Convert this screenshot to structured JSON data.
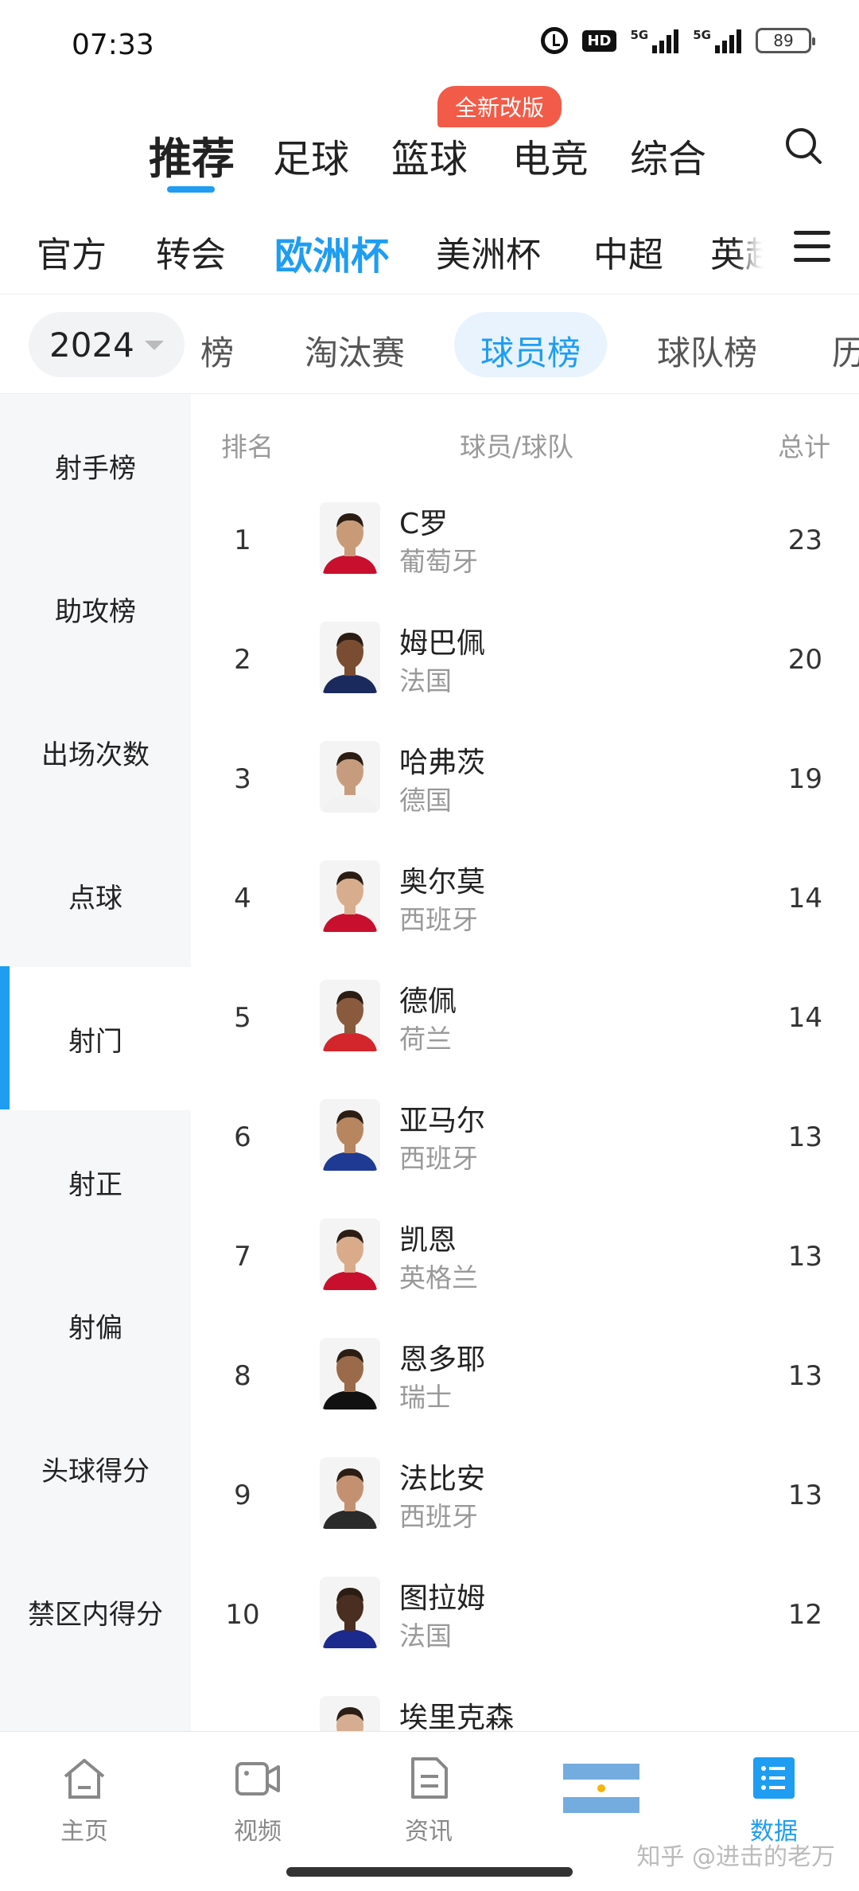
{
  "status_bar": {
    "time": "07:33",
    "hd_label": "HD",
    "signal1_label": "5G",
    "signal2_label": "5G",
    "battery": "89"
  },
  "top_tabs": {
    "items": [
      {
        "label": "推荐",
        "active": true
      },
      {
        "label": "足球",
        "active": false
      },
      {
        "label": "篮球",
        "active": false
      },
      {
        "label": "电竞",
        "active": false
      },
      {
        "label": "综合",
        "active": false
      }
    ],
    "new_badge": "全新改版"
  },
  "league_tabs": {
    "items": [
      {
        "label": "官方",
        "active": false
      },
      {
        "label": "转会",
        "active": false
      },
      {
        "label": "欧洲杯",
        "active": true
      },
      {
        "label": "美洲杯",
        "active": false
      },
      {
        "label": "中超",
        "active": false
      },
      {
        "label": "英超",
        "active": false
      }
    ]
  },
  "sub_tabs": {
    "year": "2024",
    "items": [
      {
        "label": "榜",
        "active": false
      },
      {
        "label": "淘汰赛",
        "active": false
      },
      {
        "label": "球员榜",
        "active": true
      },
      {
        "label": "球队榜",
        "active": false
      },
      {
        "label": "历",
        "active": false
      }
    ]
  },
  "side_nav": {
    "items": [
      {
        "label": "射手榜",
        "active": false
      },
      {
        "label": "助攻榜",
        "active": false
      },
      {
        "label": "出场次数",
        "active": false
      },
      {
        "label": "点球",
        "active": false
      },
      {
        "label": "射门",
        "active": true
      },
      {
        "label": "射正",
        "active": false
      },
      {
        "label": "射偏",
        "active": false
      },
      {
        "label": "头球得分",
        "active": false
      },
      {
        "label": "禁区内得分",
        "active": false
      }
    ]
  },
  "table": {
    "headers": {
      "rank": "排名",
      "player": "球员/球队",
      "total": "总计"
    },
    "rows": [
      {
        "rank": "1",
        "name": "C罗",
        "team": "葡萄牙",
        "total": "23",
        "jersey": "#c8102e",
        "skin": "#c99a78"
      },
      {
        "rank": "2",
        "name": "姆巴佩",
        "team": "法国",
        "total": "20",
        "jersey": "#1b2a5c",
        "skin": "#7a4d33"
      },
      {
        "rank": "3",
        "name": "哈弗茨",
        "team": "德国",
        "total": "19",
        "jersey": "#f2f2f2",
        "skin": "#c79c7e"
      },
      {
        "rank": "4",
        "name": "奥尔莫",
        "team": "西班牙",
        "total": "14",
        "jersey": "#c8102e",
        "skin": "#d7ad8d"
      },
      {
        "rank": "5",
        "name": "德佩",
        "team": "荷兰",
        "total": "14",
        "jersey": "#d2262c",
        "skin": "#8a5a3e"
      },
      {
        "rank": "6",
        "name": "亚马尔",
        "team": "西班牙",
        "total": "13",
        "jersey": "#1f3a93",
        "skin": "#b78560"
      },
      {
        "rank": "7",
        "name": "凯恩",
        "team": "英格兰",
        "total": "13",
        "jersey": "#c8102e",
        "skin": "#d9ab8b"
      },
      {
        "rank": "8",
        "name": "恩多耶",
        "team": "瑞士",
        "total": "13",
        "jersey": "#111111",
        "skin": "#9a6a4a"
      },
      {
        "rank": "9",
        "name": "法比安",
        "team": "西班牙",
        "total": "13",
        "jersey": "#2a2a2a",
        "skin": "#c39172"
      },
      {
        "rank": "10",
        "name": "图拉姆",
        "team": "法国",
        "total": "12",
        "jersey": "#1b2a8c",
        "skin": "#4a2e22"
      },
      {
        "rank": "",
        "name": "埃里克森",
        "team": "",
        "total": "",
        "jersey": "#c8102e",
        "skin": "#d6ad90"
      }
    ]
  },
  "bottom_nav": {
    "items": [
      {
        "label": "主页",
        "icon": "home-icon",
        "active": false
      },
      {
        "label": "视频",
        "icon": "video-icon",
        "active": false
      },
      {
        "label": "资讯",
        "icon": "news-icon",
        "active": false
      },
      {
        "label": "",
        "icon": "argentina-flag-icon",
        "active": false
      },
      {
        "label": "数据",
        "icon": "data-icon",
        "active": true
      }
    ],
    "watermark": "知乎 @进击的老万"
  },
  "colors": {
    "accent": "#1e9df2",
    "badge": "#f25b48",
    "side_bg": "#f6f7f9"
  }
}
